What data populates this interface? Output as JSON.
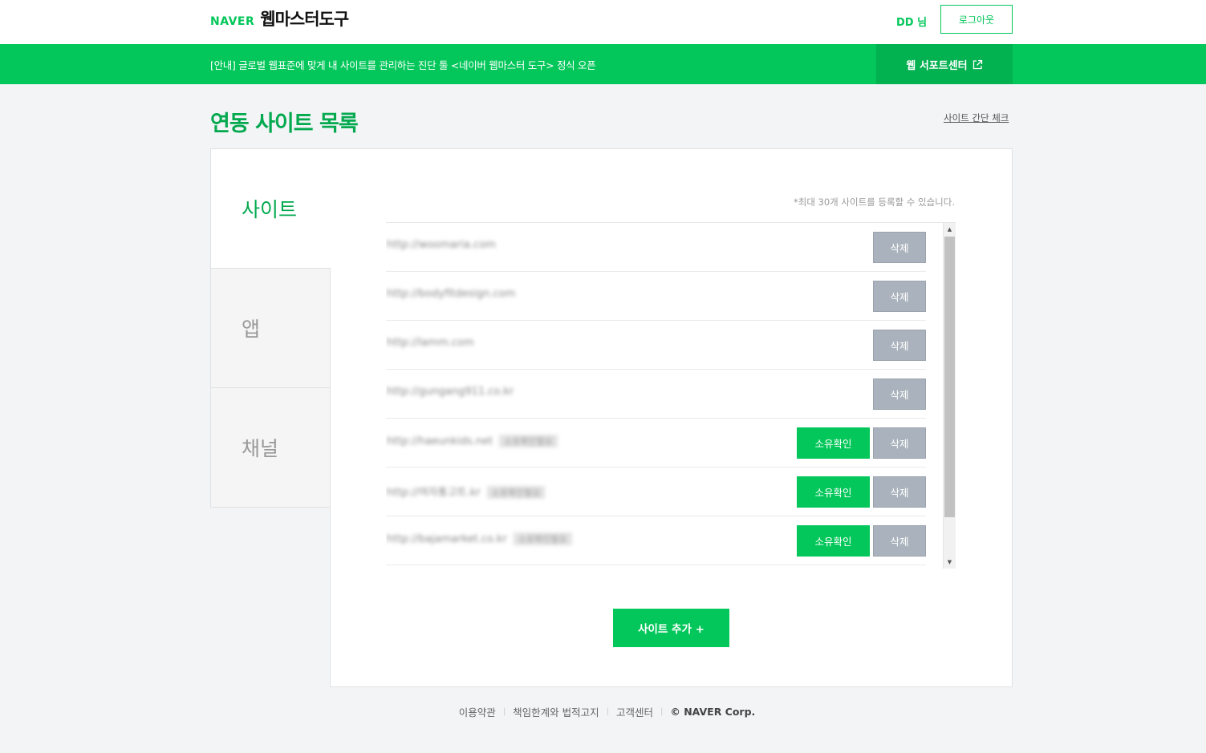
{
  "header": {
    "logo_brand": "NAVER",
    "logo_title": "웹마스터도구",
    "user_name": "DD 님",
    "logout_label": "로그아웃"
  },
  "notice": {
    "text": "[안내] 글로벌 웹표준에 맞게 내 사이트를 관리하는 진단 툴 <네이버 웹마스터 도구> 정식 오픈",
    "support_label": "웹 서포트센터"
  },
  "page": {
    "title": "연동 사이트 목록",
    "quick_check_label": "사이트 간단 체크"
  },
  "tabs": [
    {
      "label": "사이트",
      "active": true
    },
    {
      "label": "앱",
      "active": false
    },
    {
      "label": "채널",
      "active": false
    }
  ],
  "limit_note": "*최대 30개 사이트를 등록할 수 있습니다.",
  "sites": [
    {
      "url": "http://woomaria.com",
      "tag": "",
      "verify_label": "",
      "delete_label": "삭제"
    },
    {
      "url": "http://bodyfitdesign.com",
      "tag": "",
      "verify_label": "",
      "delete_label": "삭제"
    },
    {
      "url": "http://lamm.com",
      "tag": "",
      "verify_label": "",
      "delete_label": "삭제"
    },
    {
      "url": "http://gungang911.co.kr",
      "tag": "",
      "verify_label": "",
      "delete_label": "삭제"
    },
    {
      "url": "http://haeunkids.net",
      "tag": "소유확인필요",
      "verify_label": "소유확인",
      "delete_label": "삭제"
    },
    {
      "url": "http://여자통고트.kr",
      "tag": "소유확인필요",
      "verify_label": "소유확인",
      "delete_label": "삭제"
    },
    {
      "url": "http://bajamarket.co.kr",
      "tag": "소유확인필요",
      "verify_label": "소유확인",
      "delete_label": "삭제"
    }
  ],
  "add_site_label": "사이트 추가 +",
  "footer": {
    "terms": "이용약관",
    "legal": "책임한계와 법적고지",
    "support": "고객센터",
    "copyright": "© NAVER Corp."
  },
  "colors": {
    "brand_green": "#03c75a",
    "delete_gray": "#aab3bd",
    "background": "#f3f4f6"
  },
  "icons": {
    "external_link": "external-link-icon",
    "scroll_up": "arrow-up-icon",
    "scroll_down": "arrow-down-icon"
  }
}
